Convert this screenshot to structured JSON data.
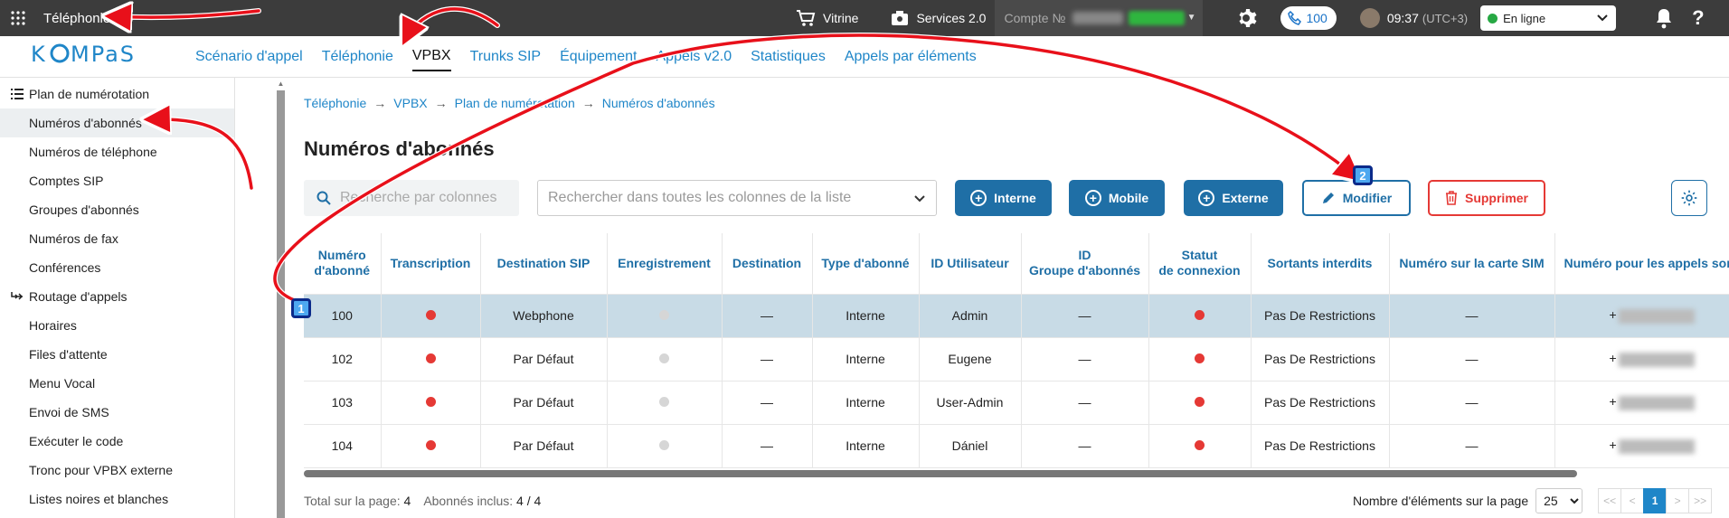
{
  "topbar": {
    "app_title": "Téléphonie",
    "vitrine": "Vitrine",
    "services": "Services 2.0",
    "account_label": "Compte №",
    "extension": "100",
    "time": "09:37",
    "tz": "(UTC+3)",
    "status": "En ligne"
  },
  "nav": {
    "logo": "KOMPAS",
    "tabs": [
      "Scénario d'appel",
      "Téléphonie",
      "VPBX",
      "Trunks SIP",
      "Équipement",
      "Appels v2.0",
      "Statistiques",
      "Appels par éléments"
    ],
    "active": "VPBX"
  },
  "sidebar": {
    "groups": [
      {
        "label": "Plan de numérotation",
        "icon": "list-icon",
        "items": [
          "Numéros d'abonnés",
          "Numéros de téléphone",
          "Comptes SIP",
          "Groupes d'abonnés",
          "Numéros de fax",
          "Conférences"
        ]
      },
      {
        "label": "Routage d'appels",
        "icon": "routing-icon",
        "items": [
          "Horaires",
          "Files d'attente",
          "Menu Vocal",
          "Envoi de SMS",
          "Exécuter le code",
          "Tronc pour VPBX externe",
          "Listes noires et blanches"
        ]
      }
    ],
    "active_item": "Numéros d'abonnés"
  },
  "breadcrumb": [
    "Téléphonie",
    "VPBX",
    "Plan de numérotation",
    "Numéros d'abonnés"
  ],
  "page_title": "Numéros d'abonnés",
  "toolbar": {
    "search_columns_placeholder": "Recherche par colonnes",
    "search_all_placeholder": "Rechercher dans toutes les colonnes de la liste",
    "btn_internal": "Interne",
    "btn_mobile": "Mobile",
    "btn_external": "Externe",
    "btn_edit": "Modifier",
    "btn_delete": "Supprimer"
  },
  "table": {
    "headers": [
      "Numéro d'abonné",
      "Transcription",
      "Destination SIP",
      "Enregistrement",
      "Destination",
      "Type d'abonné",
      "ID Utilisateur",
      "ID Groupe d'abonnés",
      "Statut de connexion",
      "Sortants interdits",
      "Numéro sur la carte SIM",
      "Numéro pour les appels sor"
    ],
    "header_lines": [
      [
        "Numéro",
        "d'abonné"
      ],
      [
        "Transcription"
      ],
      [
        "Destination SIP"
      ],
      [
        "Enregistrement"
      ],
      [
        "Destination"
      ],
      [
        "Type d'abonné"
      ],
      [
        "ID Utilisateur"
      ],
      [
        "ID",
        "Groupe d'abonnés"
      ],
      [
        "Statut",
        "de connexion"
      ],
      [
        "Sortants interdits"
      ],
      [
        "Numéro sur la carte SIM"
      ],
      [
        "Numéro pour les appels sor"
      ]
    ],
    "rows": [
      {
        "number": "100",
        "transcription": "red",
        "sip_dest": "Webphone",
        "recording": "grey",
        "destination": "—",
        "type": "Interne",
        "user_id": "Admin",
        "group_id": "—",
        "conn": "red",
        "restrictions": "Pas De Restrictions",
        "sim": "—",
        "outgoing": "+",
        "selected": true
      },
      {
        "number": "102",
        "transcription": "red",
        "sip_dest": "Par Défaut",
        "recording": "grey",
        "destination": "—",
        "type": "Interne",
        "user_id": "Eugene",
        "group_id": "—",
        "conn": "red",
        "restrictions": "Pas De Restrictions",
        "sim": "—",
        "outgoing": "+",
        "selected": false
      },
      {
        "number": "103",
        "transcription": "red",
        "sip_dest": "Par Défaut",
        "recording": "grey",
        "destination": "—",
        "type": "Interne",
        "user_id": "User-Admin",
        "group_id": "—",
        "conn": "red",
        "restrictions": "Pas De Restrictions",
        "sim": "—",
        "outgoing": "+",
        "selected": false
      },
      {
        "number": "104",
        "transcription": "red",
        "sip_dest": "Par Défaut",
        "recording": "grey",
        "destination": "—",
        "type": "Interne",
        "user_id": "Dániel",
        "group_id": "—",
        "conn": "red",
        "restrictions": "Pas De Restrictions",
        "sim": "—",
        "outgoing": "+",
        "selected": false
      }
    ]
  },
  "footer": {
    "total_label": "Total sur la page:",
    "total_value": "4",
    "included_label": "Abonnés inclus:",
    "included_value": "4 / 4",
    "per_page_label": "Nombre d'éléments sur la page",
    "per_page_value": "25",
    "pager": [
      "<<",
      "<",
      "1",
      ">",
      ">>"
    ],
    "current_page": "1"
  },
  "annotations": {
    "badge1": "1",
    "badge2": "2"
  },
  "colors": {
    "accent": "#1f6fa6",
    "link": "#1f86c8",
    "danger": "#e53935",
    "arrow": "#e8101a",
    "badge": "#4da8f0"
  }
}
